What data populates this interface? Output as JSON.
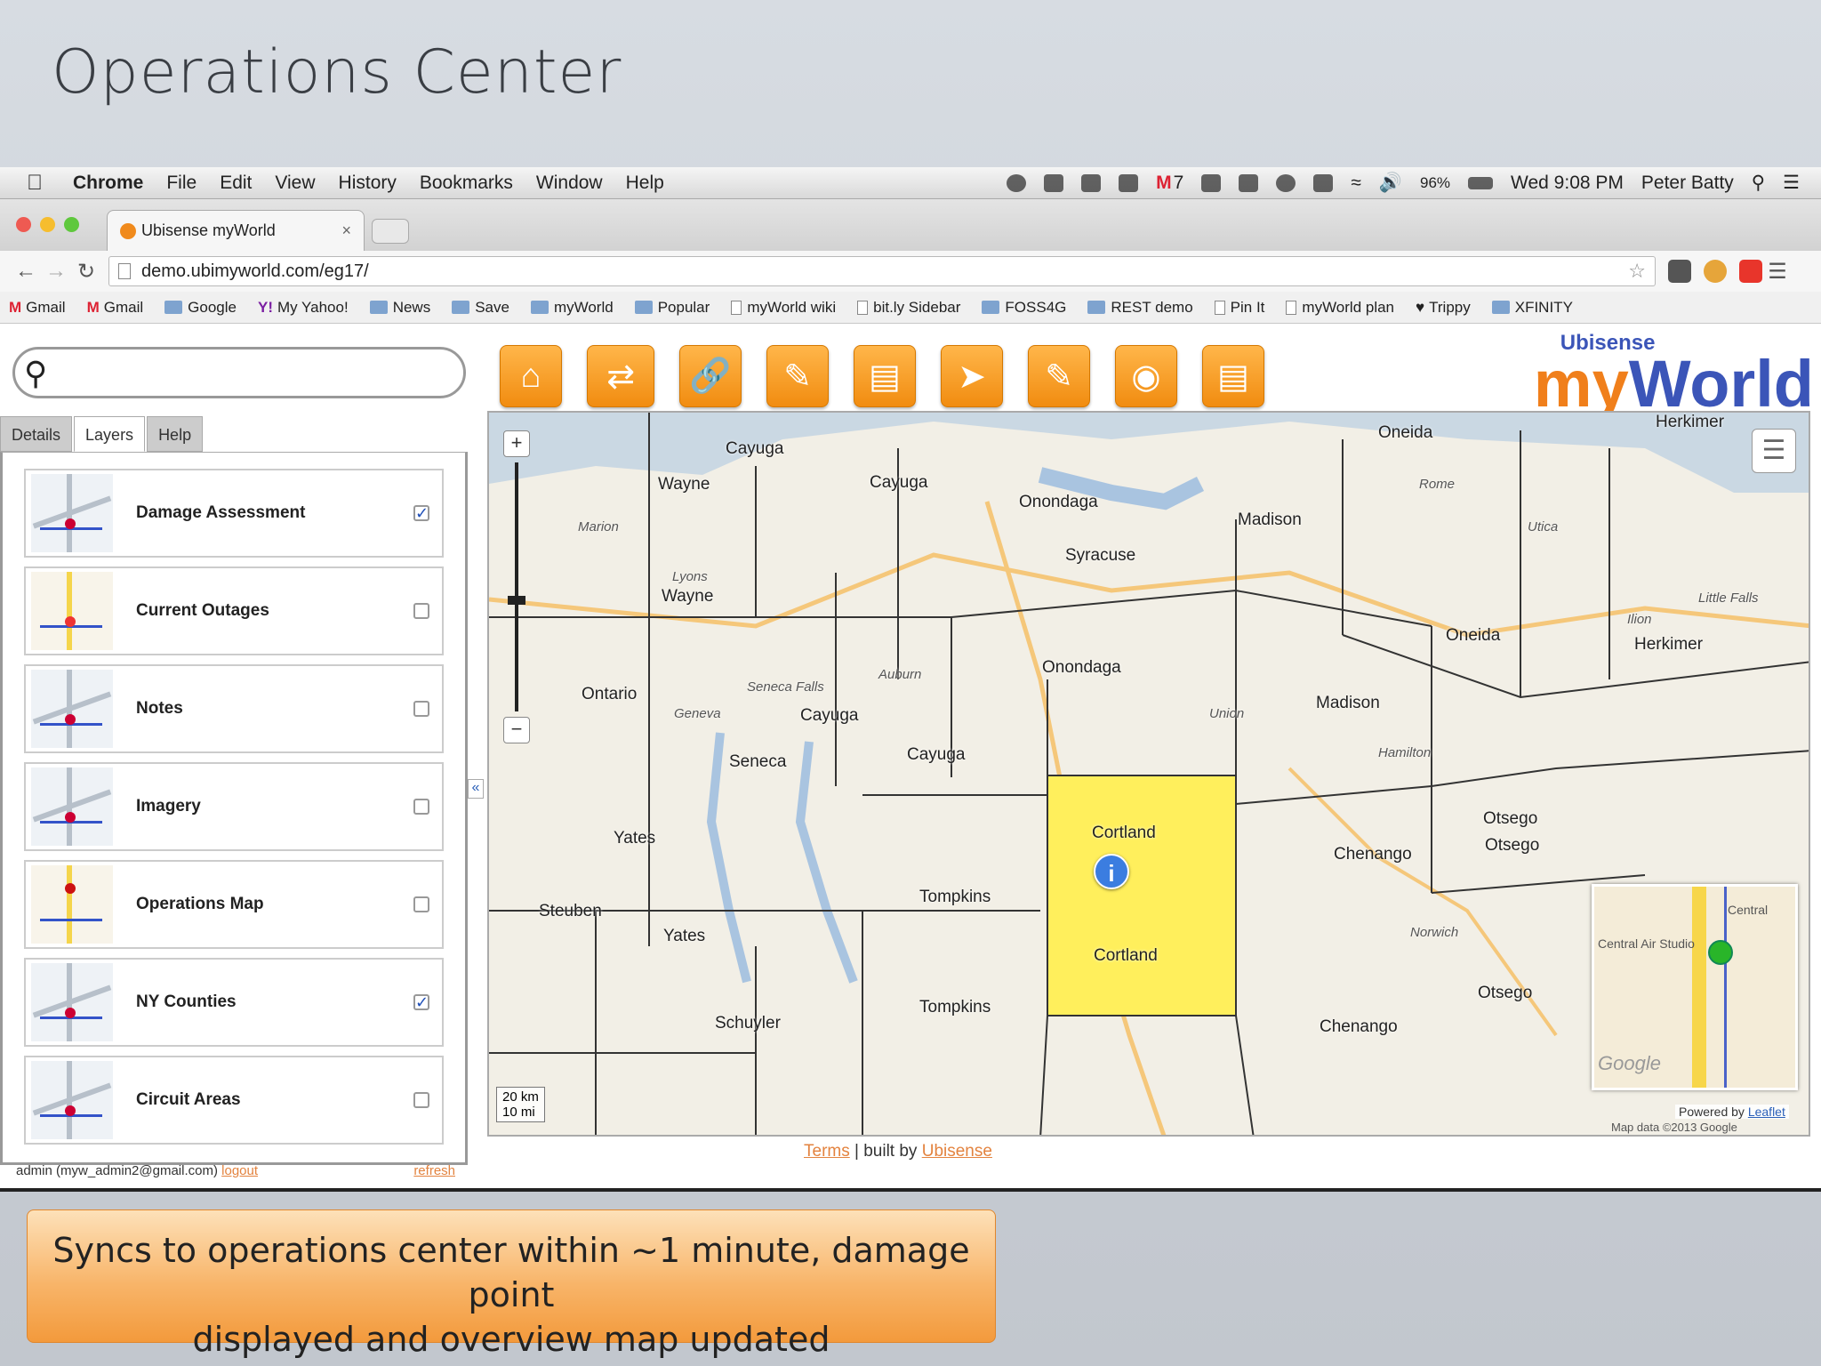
{
  "slide": {
    "title": "Operations Center",
    "caption_line1": "Syncs to operations center within ~1 minute, damage point",
    "caption_line2": "displayed and overview map updated"
  },
  "menubar": {
    "app": "Chrome",
    "items": [
      "File",
      "Edit",
      "View",
      "History",
      "Bookmarks",
      "Window",
      "Help"
    ],
    "gmail_count": "7",
    "battery": "96%",
    "clock": "Wed 9:08 PM",
    "user": "Peter Batty"
  },
  "browser": {
    "tab_title": "Ubisense myWorld",
    "tab_close": "×",
    "url": "demo.ubimyworld.com/eg17/",
    "bookmarks": [
      {
        "label": "Gmail",
        "icon": "gmail"
      },
      {
        "label": "Gmail",
        "icon": "gmail"
      },
      {
        "label": "Google",
        "icon": "folder"
      },
      {
        "label": "My Yahoo!",
        "icon": "yahoo"
      },
      {
        "label": "News",
        "icon": "folder"
      },
      {
        "label": "Save",
        "icon": "folder"
      },
      {
        "label": "myWorld",
        "icon": "folder"
      },
      {
        "label": "Popular",
        "icon": "folder"
      },
      {
        "label": "myWorld wiki",
        "icon": "doc"
      },
      {
        "label": "bit.ly Sidebar",
        "icon": "doc"
      },
      {
        "label": "FOSS4G",
        "icon": "folder"
      },
      {
        "label": "REST demo",
        "icon": "folder"
      },
      {
        "label": "Pin It",
        "icon": "doc"
      },
      {
        "label": "myWorld plan",
        "icon": "doc"
      },
      {
        "label": "Trippy",
        "icon": "heart"
      },
      {
        "label": "XFINITY",
        "icon": "folder"
      }
    ]
  },
  "app": {
    "brand_top": "Ubisense",
    "brand_my": "my",
    "brand_world": "World",
    "search_placeholder": "",
    "tabs": [
      "Details",
      "Layers",
      "Help"
    ],
    "layers": [
      {
        "name": "Damage Assessment",
        "checked": true
      },
      {
        "name": "Current Outages",
        "checked": false
      },
      {
        "name": "Notes",
        "checked": false
      },
      {
        "name": "Imagery",
        "checked": false
      },
      {
        "name": "Operations Map",
        "checked": false
      },
      {
        "name": "NY Counties",
        "checked": true
      },
      {
        "name": "Circuit Areas",
        "checked": false
      }
    ],
    "user_email": "admin (myw_admin2@gmail.com)",
    "logout": "logout",
    "refresh": "refresh",
    "footer_terms": "Terms",
    "footer_built": " | built by ",
    "footer_company": "Ubisense"
  },
  "map": {
    "scale_km": "20 km",
    "scale_mi": "10 mi",
    "labels": [
      "Cayuga",
      "Wayne",
      "Cayuga",
      "Onondaga",
      "Syracuse",
      "Madison",
      "Oneida",
      "Rome",
      "Utica",
      "Herkimer",
      "Herkimer",
      "Oneida",
      "Onondaga",
      "Ontario",
      "Auburn",
      "Seneca Falls",
      "Geneva",
      "Cayuga",
      "Seneca",
      "Cayuga",
      "Madison",
      "Yates",
      "Yates",
      "Steuben",
      "Tompkins",
      "Cortland",
      "Cortland",
      "Chenango",
      "Otsego",
      "Otsego",
      "Norwich",
      "Otsego",
      "Chenango",
      "Schuyler",
      "Tompkins",
      "Hamilton",
      "Little Falls",
      "Ilion",
      "Wayne",
      "Lyons",
      "Marion",
      "Union"
    ],
    "overview_text1": "Central Air Studio",
    "overview_text2": "Central",
    "overview_watermark": "Google",
    "powered_by": "Powered by ",
    "leaflet": "Leaflet",
    "map_data": "Map data ©2013 Google"
  },
  "colors": {
    "toolbar_orange": "#f18c10",
    "brand_blue": "#3b55b8",
    "highlight_county": "#ffef5c"
  }
}
